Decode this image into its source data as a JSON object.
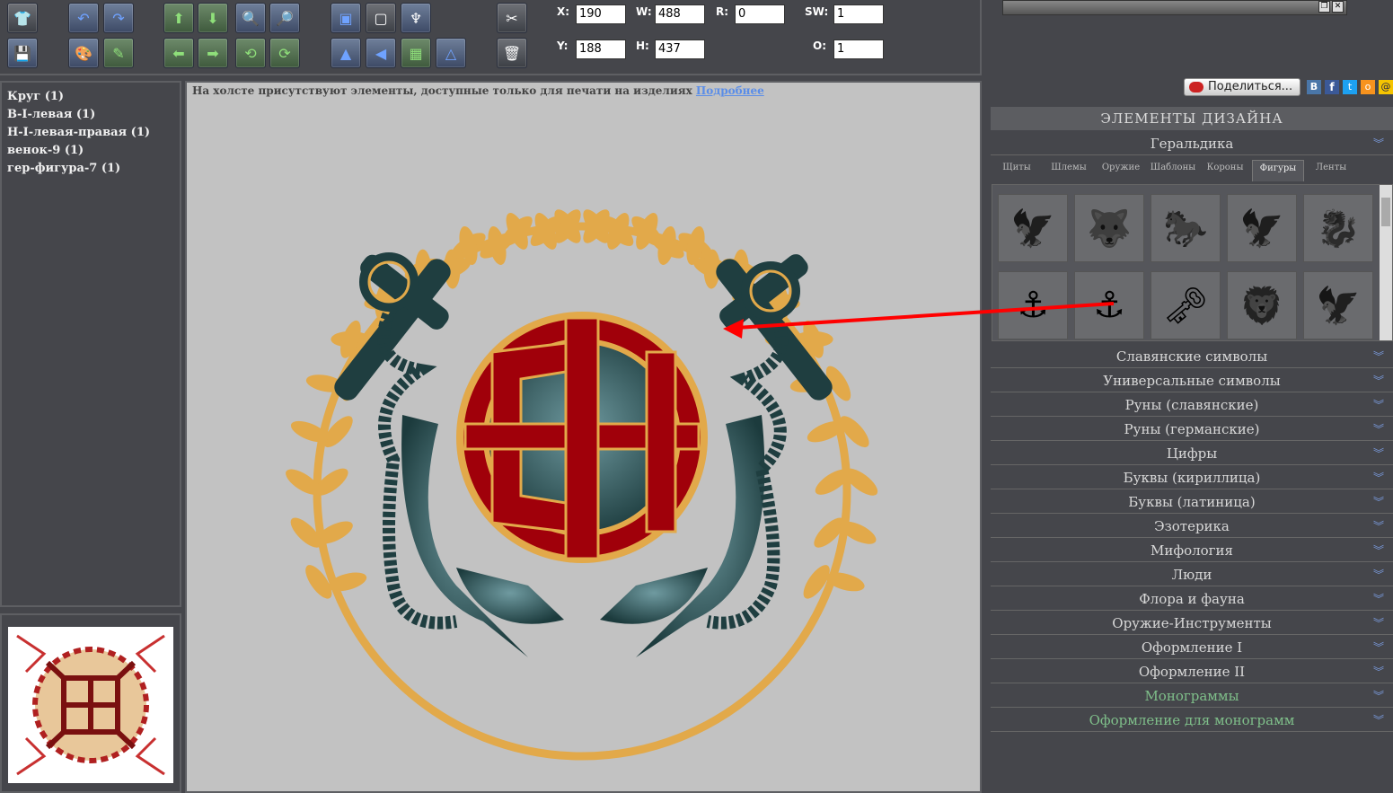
{
  "coords": {
    "x_label": "X:",
    "x_value": "190",
    "y_label": "Y:",
    "y_value": "188",
    "w_label": "W:",
    "w_value": "488",
    "h_label": "H:",
    "h_value": "437",
    "r_label": "R:",
    "r_value": "0",
    "sw_label": "SW:",
    "sw_value": "1",
    "o_label": "O:",
    "o_value": "1"
  },
  "layers": [
    "Круг (1)",
    "В-I-левая (1)",
    "Н-I-левая-правая (1)",
    "венок-9 (1)",
    "гер-фигура-7 (1)"
  ],
  "canvas": {
    "notice": "На холсте присутствуют элементы, доступные только для печати на изделиях",
    "notice_link": "Подробнее"
  },
  "share": {
    "label": "Поделиться..."
  },
  "design": {
    "title": "ЭЛЕМЕНТЫ ДИЗАЙНА",
    "open_category": "Геральдика",
    "subtabs": [
      "Щиты",
      "Шлемы",
      "Оружие",
      "Шаблоны",
      "Короны",
      "Фигуры",
      "Ленты"
    ],
    "active_subtab": "Фигуры",
    "figures": [
      "eagle-figure",
      "wolf-figure",
      "horse-figure",
      "phoenix-figure",
      "griffin-figure",
      "anchors-figure",
      "crossed-anchors-figure",
      "crossed-keys-figure",
      "lion-figure",
      "double-eagle-figure"
    ],
    "categories": [
      "Славянские символы",
      "Универсальные символы",
      "Руны (славянские)",
      "Руны (германские)",
      "Цифры",
      "Буквы (кириллица)",
      "Буквы (латиница)",
      "Эзотерика",
      "Мифология",
      "Люди",
      "Флора и фауна",
      "Оружие-Инструменты",
      "Оформление I",
      "Оформление II",
      "Монограммы",
      "Оформление для монограмм"
    ]
  },
  "colors": {
    "panel_bg": "#45464b",
    "canvas_bg": "#c2c2c2",
    "wreath": "#e2a94a",
    "anchor": "#1f3e40",
    "monogram_red": "#a0000a",
    "arrow": "#ff0000"
  }
}
